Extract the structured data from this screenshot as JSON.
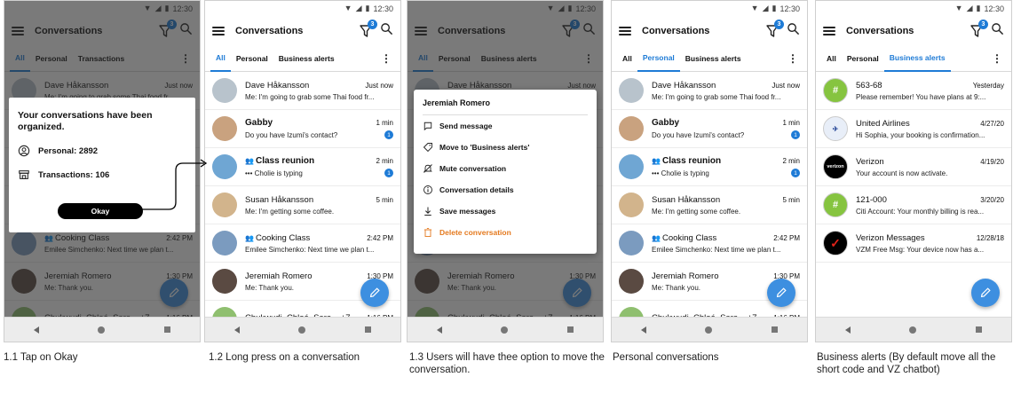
{
  "status": {
    "time": "12:30"
  },
  "app": {
    "title": "Conversations",
    "filter_badge": "3"
  },
  "tabs_main": [
    "All",
    "Personal",
    "Business alerts"
  ],
  "tabs_first": [
    "All",
    "Personal",
    "Transactions"
  ],
  "conversations": [
    {
      "name": "Dave Håkansson",
      "time": "Just now",
      "msg": "Me: I'm going to grab some Thai food fr...",
      "bold": false,
      "badge": "",
      "color": "#b8c3cc"
    },
    {
      "name": "Gabby",
      "time": "1 min",
      "msg": "Do you have Izumi's contact?",
      "bold": true,
      "badge": "1",
      "color": "#c9a27f"
    },
    {
      "name": "Class reunion",
      "time": "2 min",
      "msg": "••• Cholie is typing",
      "bold": true,
      "badge": "1",
      "color": "#6fa6d3",
      "group": true
    },
    {
      "name": "Susan Håkansson",
      "time": "5 min",
      "msg": "Me: I'm getting some coffee.",
      "bold": false,
      "badge": "",
      "color": "#d2b48c"
    },
    {
      "name": "Cooking Class",
      "time": "2:42 PM",
      "msg": "Emilee Simchenko: Next time we plan t...",
      "bold": false,
      "badge": "",
      "color": "#7b9bbf",
      "group": true
    },
    {
      "name": "Jeremiah Romero",
      "time": "1:30 PM",
      "msg": "Me: Thank you.",
      "bold": false,
      "badge": "",
      "color": "#5a4a42"
    },
    {
      "name": "Chukwudi, Chloé, Sara... +7",
      "time": "1:16 PM",
      "msg": "",
      "bold": false,
      "badge": "",
      "color": "#8fbf6f"
    }
  ],
  "business": [
    {
      "name": "563-68",
      "time": "Yesterday",
      "msg": "Please remember! You have plans at 9:...",
      "color": "#86c440",
      "mark": "#"
    },
    {
      "name": "United Airlines",
      "time": "4/27/20",
      "msg": "Hi Sophia, your booking is confirmation...",
      "color": "#e8eef8",
      "mark": ""
    },
    {
      "name": "Verizon",
      "time": "4/19/20",
      "msg": "Your account is now activate.",
      "color": "#000000",
      "mark": "verizon"
    },
    {
      "name": "121-000",
      "time": "3/20/20",
      "msg": "Citi Account: Your monthly billing is rea...",
      "color": "#86c440",
      "mark": "#"
    },
    {
      "name": "Verizon Messages",
      "time": "12/28/18",
      "msg": "VZM Free Msg: Your device now has a...",
      "color": "#000000",
      "mark": "✓"
    }
  ],
  "dialog": {
    "title": "Your conversations have been organized.",
    "personal": "Personal: 2892",
    "transactions": "Transactions: 106",
    "ok": "Okay"
  },
  "menu": {
    "title": "Jeremiah Romero",
    "items": [
      "Send message",
      "Move to 'Business alerts'",
      "Mute conversation",
      "Conversation details",
      "Save messages",
      "Delete conversation"
    ]
  },
  "captions": [
    "1.1 Tap on Okay",
    "1.2 Long press on a conversation",
    "1.3 Users will have thee option to move the conversation.",
    "Personal conversations",
    "Business alerts (By default move all the short code and VZ chatbot)"
  ],
  "colors": {
    "accent": "#1e7bd6",
    "danger": "#e4791e"
  }
}
